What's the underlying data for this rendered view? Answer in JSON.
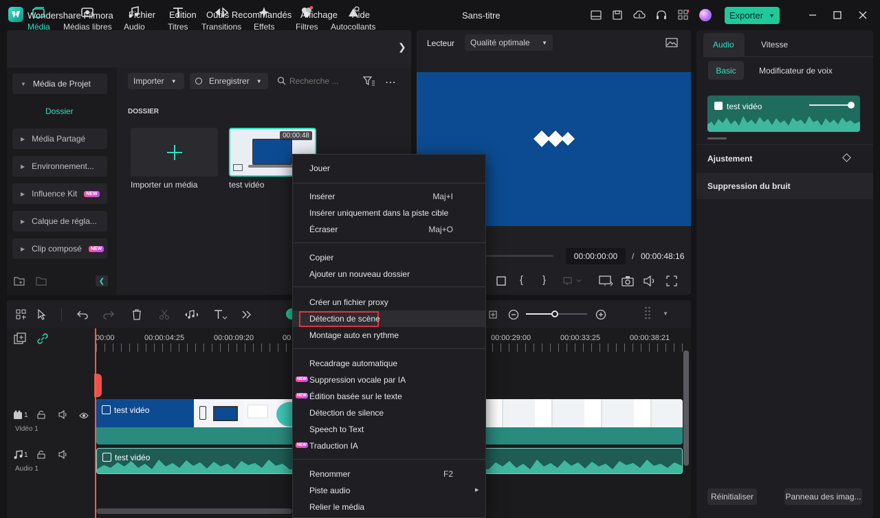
{
  "app": {
    "title": "Wondershare Filmora",
    "document_title": "Sans-titre",
    "menu": [
      "Fichier",
      "Edition",
      "Outils Recommandés",
      "Affichage",
      "Aide"
    ],
    "export_label": "Exporter"
  },
  "media_tabs": [
    {
      "label": "Média",
      "icon": "media-icon",
      "active": true
    },
    {
      "label": "Médias libres",
      "icon": "stock-media-icon"
    },
    {
      "label": "Audio",
      "icon": "music-note-icon"
    },
    {
      "label": "Titres",
      "icon": "title-text-icon"
    },
    {
      "label": "Transitions",
      "icon": "transition-icon"
    },
    {
      "label": "Effets",
      "icon": "sparkle-icon"
    },
    {
      "label": "Filtres",
      "icon": "filter-icon"
    },
    {
      "label": "Autocollants",
      "icon": "sticker-icon"
    }
  ],
  "media_sidebar": {
    "project_media": "Média de Projet",
    "folder": "Dossier",
    "items": [
      {
        "label": "Média Partagé",
        "new": false
      },
      {
        "label": "Environnement...",
        "new": false
      },
      {
        "label": "Influence Kit",
        "new": true
      },
      {
        "label": "Calque de régla...",
        "new": false
      },
      {
        "label": "Clip composé",
        "new": true
      }
    ],
    "new_badge": "NEW"
  },
  "media_toolbar": {
    "import": "Importer",
    "record": "Enregistrer",
    "search_placeholder": "Recherche ..."
  },
  "media_grid": {
    "section": "DOSSIER",
    "import_label": "Importer un média",
    "clip_label": "test vidéo",
    "clip_duration": "00:00:48"
  },
  "player": {
    "label": "Lecteur",
    "quality": "Qualité optimale",
    "current_time": "00:00:00:00",
    "separator": "/",
    "total_time": "00:00:48:16"
  },
  "right_panel": {
    "tabs": [
      "Audio",
      "Vitesse"
    ],
    "subtabs": [
      "Basic",
      "Modificateur de voix"
    ],
    "clip_name": "test vidéo",
    "adjustment": "Ajustement",
    "noise": "Suppression du bruit",
    "reset": "Réinitialiser",
    "panel_button": "Panneau des imag..."
  },
  "timeline": {
    "ruler": [
      "00:00",
      "00:00:04:25",
      "00:00:09:20",
      "00",
      "00:00:29:00",
      "00:00:33:25",
      "00:00:38:21"
    ],
    "video_track_label": "Vidéo 1",
    "audio_track_label": "Audio 1",
    "track_number": "1",
    "clip_name": "test vidéo"
  },
  "context_menu": {
    "groups": [
      [
        {
          "label": "Jouer"
        }
      ],
      [
        {
          "label": "Insérer",
          "shortcut": "Maj+I"
        },
        {
          "label": "Insérer uniquement dans la piste cible"
        },
        {
          "label": "Écraser",
          "shortcut": "Maj+O"
        }
      ],
      [
        {
          "label": "Copier"
        },
        {
          "label": "Ajouter un nouveau dossier"
        }
      ],
      [
        {
          "label": "Créer un fichier proxy"
        },
        {
          "label": "Détection de scène",
          "highlighted": true
        },
        {
          "label": "Montage auto en rythme"
        }
      ],
      [
        {
          "label": "Recadrage automatique"
        },
        {
          "label": "Suppression vocale par IA",
          "new": true
        },
        {
          "label": "Édition basée sur le texte",
          "new": true
        },
        {
          "label": "Détection de silence"
        },
        {
          "label": "Speech to Text"
        },
        {
          "label": "Traduction IA",
          "new": true
        }
      ],
      [
        {
          "label": "Renommer",
          "shortcut": "F2"
        },
        {
          "label": "Piste audio",
          "submenu": true
        },
        {
          "label": "Relier le média"
        }
      ]
    ],
    "new_badge": "NEW"
  },
  "colors": {
    "accent": "#1fc99a",
    "accent_text": "#2fe0c0",
    "preview_bg": "#0c4b91",
    "highlight_box": "#e0323c",
    "playhead": "#ff5a4a"
  }
}
